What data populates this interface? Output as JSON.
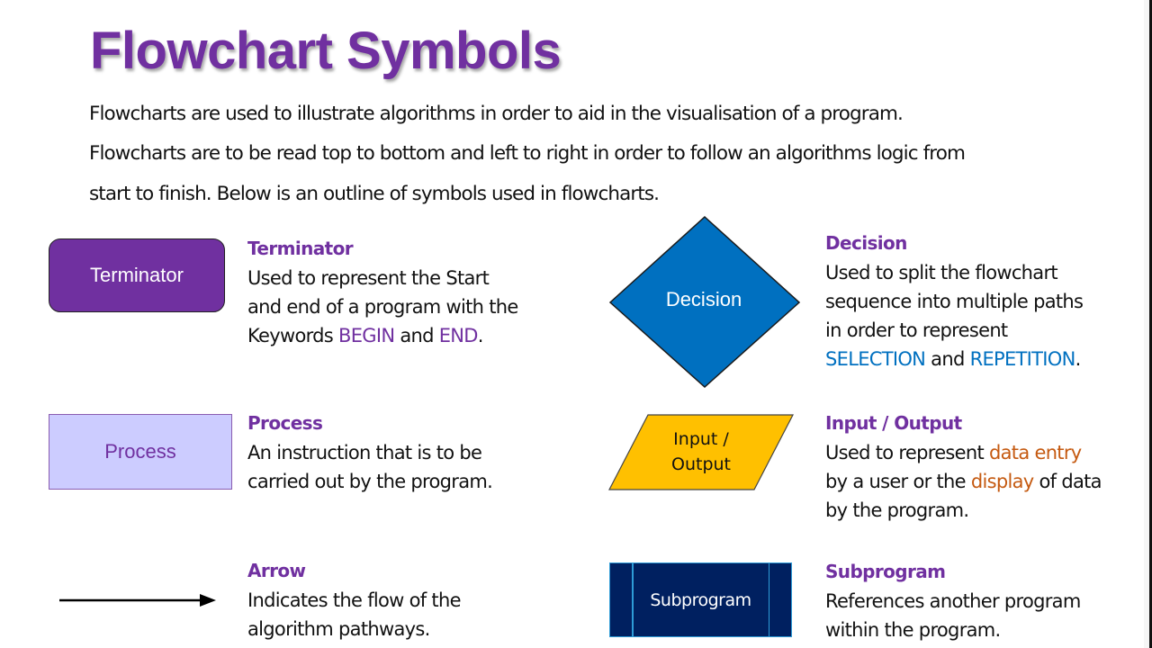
{
  "title": "Flowchart Symbols",
  "intro": [
    "Flowcharts are used to illustrate algorithms in order to aid in the visualisation of a program.",
    "Flowcharts are to be read top to bottom and left to right in order to follow an algorithms logic from",
    "start to finish. Below is an outline of symbols used in flowcharts."
  ],
  "colors": {
    "title": "#7030a0",
    "terminator_fill": "#7030a0",
    "process_fill": "#ccccff",
    "decision_fill": "#0070c0",
    "io_fill": "#ffc000",
    "subprogram_fill": "#002060",
    "keyword_purple": "#7030a0",
    "keyword_blue": "#0070c0",
    "keyword_orange": "#c55a11"
  },
  "symbols": {
    "terminator": {
      "shape_label": "Terminator",
      "heading": "Terminator",
      "lines": [
        "Used to represent the Start",
        "and end of a program with the"
      ],
      "line3_pre": "Keywords ",
      "kw1": "BEGIN",
      "mid": " and ",
      "kw2": "END",
      "end": "."
    },
    "process": {
      "shape_label": "Process",
      "heading": "Process",
      "lines": [
        "An instruction that is to be",
        "carried out by the program."
      ]
    },
    "arrow": {
      "heading": "Arrow",
      "lines": [
        "Indicates the flow of the",
        "algorithm pathways."
      ]
    },
    "decision": {
      "shape_label": "Decision",
      "heading": "Decision",
      "lines": [
        "Used to split the flowchart",
        "sequence into multiple paths",
        "in order to represent"
      ],
      "kw1": "SELECTION",
      "mid": " and ",
      "kw2": "REPETITION",
      "end": "."
    },
    "io": {
      "shape_label_1": "Input /",
      "shape_label_2": "Output",
      "heading": "Input / Output",
      "l1_pre": "Used to represent ",
      "l1_kw": "data entry",
      "l2_pre": "by a user or the ",
      "l2_kw": "display",
      "l2_post": " of data",
      "l3": "by the program."
    },
    "subprogram": {
      "shape_label": "Subprogram",
      "heading": "Subprogram",
      "lines": [
        "References another program",
        "within the program."
      ]
    }
  }
}
